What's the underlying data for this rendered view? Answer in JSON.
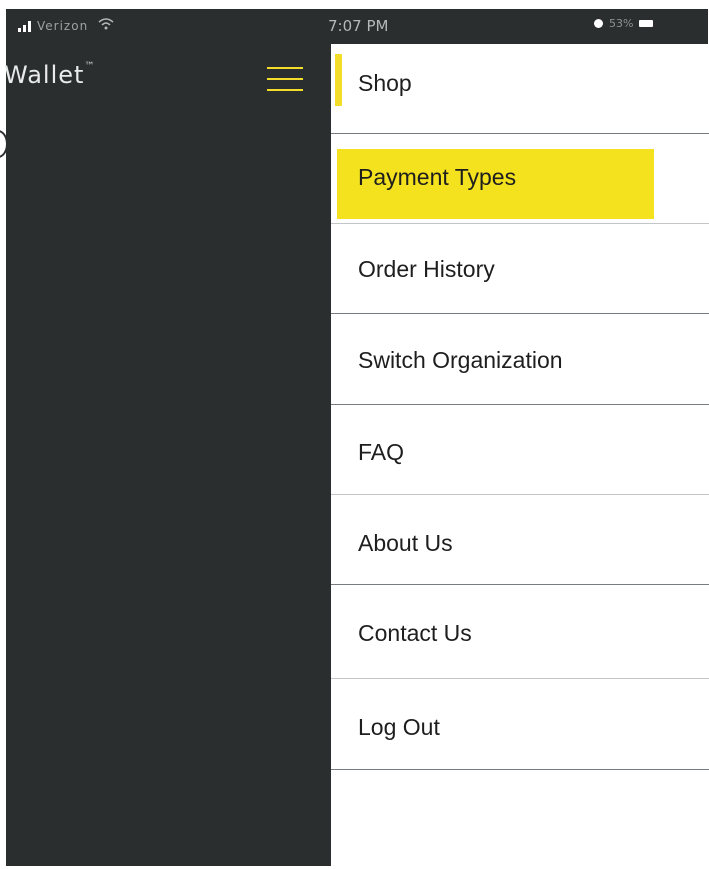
{
  "status_bar": {
    "carrier": "Verizon",
    "time": "7:07 PM",
    "battery": "53%"
  },
  "header": {
    "app_title": "Wallet",
    "title_mark": "™"
  },
  "menu": {
    "items": [
      {
        "label": "Shop"
      },
      {
        "label": "Payment Types"
      },
      {
        "label": "Order History"
      },
      {
        "label": "Switch Organization"
      },
      {
        "label": "FAQ"
      },
      {
        "label": "About Us"
      },
      {
        "label": "Contact Us"
      },
      {
        "label": "Log Out"
      }
    ]
  },
  "colors": {
    "panel_background": "#2b2e2f",
    "accent_yellow": "#f2de2a",
    "menu_background": "#ffffff",
    "menu_text": "#1e1e1e"
  },
  "icons": {
    "menu_toggle": "hamburger-icon",
    "wifi": "wifi-icon",
    "signal": "signal-icon",
    "battery": "battery-icon"
  }
}
